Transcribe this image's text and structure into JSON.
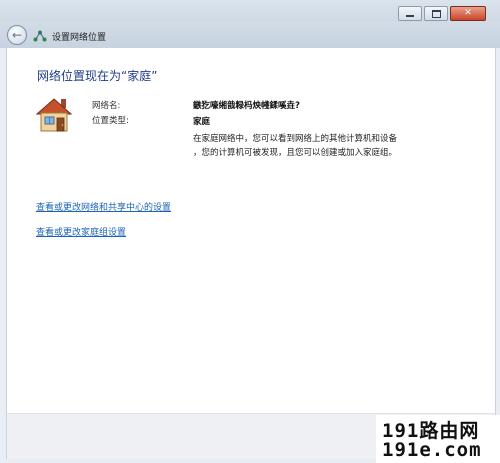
{
  "window": {
    "title": "设置网络位置",
    "controls": {
      "minimize": "minimize",
      "maximize": "maximize",
      "close": "close"
    }
  },
  "content": {
    "heading": "网络位置现在为“家庭”",
    "network_name_label": "网络名:",
    "network_name_value": "鏃犵嚎缃戠粶杩炴帴鍒嗘垚?",
    "location_type_label": "位置类型:",
    "location_type_value": "家庭",
    "description_line1": "在家庭网络中，您可以看到网络上的其他计算机和设备",
    "description_line2": "，您的计算机可被发现，且您可以创建或加入家庭组。",
    "links": [
      "查看或更改网络和共享中心的设置",
      "查看或更改家庭组设置"
    ]
  },
  "watermark": {
    "line1": "191路由网",
    "line2": "191e.com"
  },
  "icons": {
    "back": "back-arrow-icon",
    "network": "network-icon",
    "home": "house-icon"
  }
}
